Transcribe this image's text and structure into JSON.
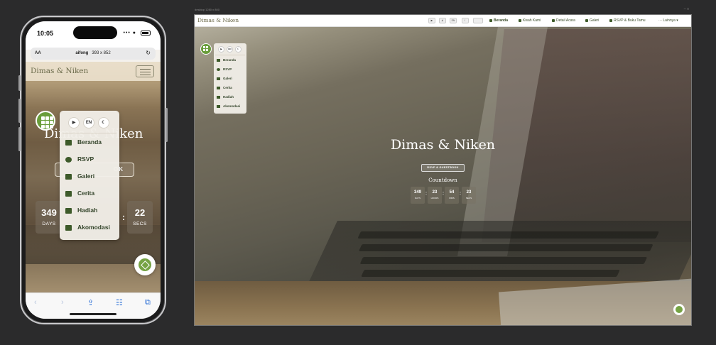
{
  "phone": {
    "time": "10:05",
    "signal": "••• ●",
    "url_aa": "AA",
    "url_brand": "aifong",
    "url_size": "393 x 852",
    "reload_icon": "↻",
    "header_title": "Dimas & Niken",
    "hero_title": "Dimas & Niken",
    "rsvp_button": "OK",
    "menu": {
      "controls": [
        "▶",
        "EN",
        "☾"
      ],
      "items": [
        "Beranda",
        "RSVP",
        "Galeri",
        "Cerita",
        "Hadiah",
        "Akomodasi"
      ]
    },
    "countdown": {
      "days_value": "349",
      "days_label": "DAYS",
      "secs_value": "22",
      "secs_label": "SECS",
      "separator": ":"
    },
    "browser": {
      "back": "‹",
      "forward": "›",
      "share": "⇪",
      "bookmarks": "☷",
      "tabs": "⧉"
    }
  },
  "desktop": {
    "window_label": "desktop 1280 x 800",
    "window_controls": "– □",
    "brand": "Dimas & Niken",
    "toolbar": [
      "▶",
      "≶",
      "EN",
      "☾"
    ],
    "nav": {
      "beranda": "Beranda",
      "kisah": "Kisah Kami",
      "detail": "Detail Acara",
      "galeri": "Galeri",
      "rsvp": "RSVP & Buku Tamu",
      "lainnya": "⋯ Lainnya ▾"
    },
    "menu": {
      "controls": [
        "▶",
        "EN",
        "☾"
      ],
      "items": [
        "Beranda",
        "RSVP",
        "Galeri",
        "Cerita",
        "Hadiah",
        "Akomodasi"
      ]
    },
    "hero_title": "Dimas & Niken",
    "rsvp_button": "RSVP & GUESTBOOK",
    "countdown_title": "Countdown",
    "countdown": {
      "days": "349",
      "days_label": "DAYS",
      "hours": "23",
      "hours_label": "HOURS",
      "mins": "54",
      "mins_label": "MINS",
      "secs": "23",
      "secs_label": "SECS",
      "separator": ":"
    }
  },
  "colors": {
    "accent_green": "#6a9d3c",
    "menu_text": "#33442a",
    "brand_text": "#6c6a4b"
  }
}
